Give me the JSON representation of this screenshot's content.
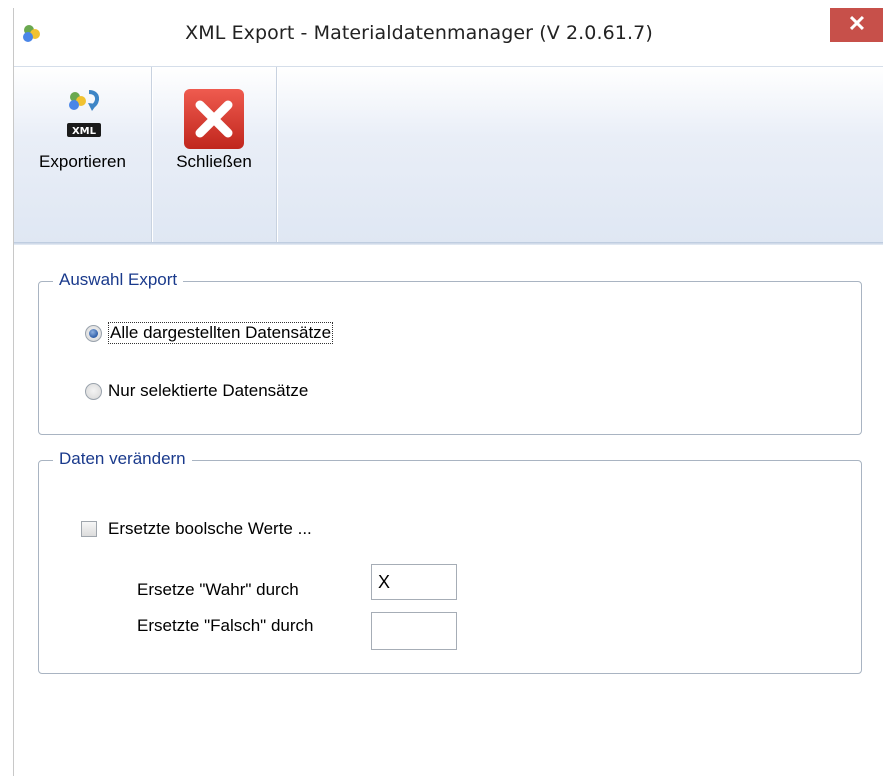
{
  "window": {
    "title": "XML Export - Materialdatenmanager (V 2.0.61.7)",
    "close_label": "✕"
  },
  "ribbon": {
    "buttons": [
      {
        "label": "Exportieren",
        "icon": "xml-export-icon",
        "badge": "XML"
      },
      {
        "label": "Schließen",
        "icon": "close-red-icon"
      }
    ]
  },
  "export_selection": {
    "legend": "Auswahl Export",
    "options": [
      {
        "label": "Alle dargestellten Datensätze",
        "checked": true
      },
      {
        "label": "Nur selektierte Datensätze",
        "checked": false
      }
    ]
  },
  "modify_data": {
    "legend": "Daten verändern",
    "replace_checkbox": {
      "label": "Ersetzte boolsche Werte ...",
      "checked": false
    },
    "true_field": {
      "label": "Ersetze \"Wahr\" durch",
      "value": "X"
    },
    "false_field": {
      "label": "Ersetzte \"Falsch\" durch",
      "value": ""
    }
  },
  "colors": {
    "close_button": "#c7504a",
    "legend_text": "#1a3a8c",
    "radio_selected": "#2f5ea8"
  }
}
